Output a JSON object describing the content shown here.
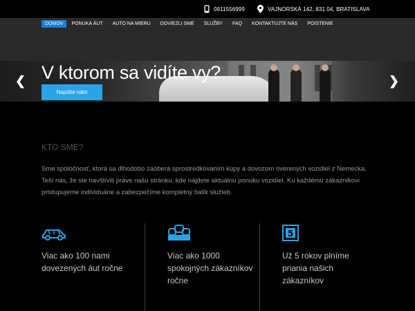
{
  "topbar": {
    "phone": "0911556999",
    "address": "VAJNORSKÁ 142, 831 04, BRATISLAVA"
  },
  "nav": {
    "items": [
      {
        "label": "DOMOV",
        "active": true
      },
      {
        "label": "PONUKA ÁUT"
      },
      {
        "label": "AUTO NA MIERU"
      },
      {
        "label": "DOVIEZLI SME"
      },
      {
        "label": "SLUŽBY"
      },
      {
        "label": "FAQ"
      },
      {
        "label": "KONTAKTUJTE NÁS"
      },
      {
        "label": "POISTENIE"
      }
    ]
  },
  "hero": {
    "title": "V ktorom sa vidíte vy?",
    "cta": "Napište nám"
  },
  "about": {
    "title": "KTO SME?",
    "text": "Sme spoločnosť, ktorá sa dlhodobo zaoberá sprostredkovaním kúpy a dovozom overených vozidiel z Nemecka. Teší nás, že ste navštívili práve našu stránku, kde nájdete aktuálnu ponuku vozidiel. Ku každému zákazníkovi pristupujeme individuáne a zabezpečíme kompletný balík služieb."
  },
  "features": [
    {
      "icon": "car-icon",
      "text": "Viac ako 100 nami dovezených áut ročne"
    },
    {
      "icon": "customers-icon",
      "text": "Viac ako 1000 spokojných zákazníkov ročne"
    },
    {
      "icon": "calendar-five-icon",
      "text": "Už 5 rokov plníme priania našich zákazníkov"
    }
  ],
  "colors": {
    "accent": "#29a3e6",
    "nav_active": "#1a7fd6",
    "background": "#000000"
  }
}
